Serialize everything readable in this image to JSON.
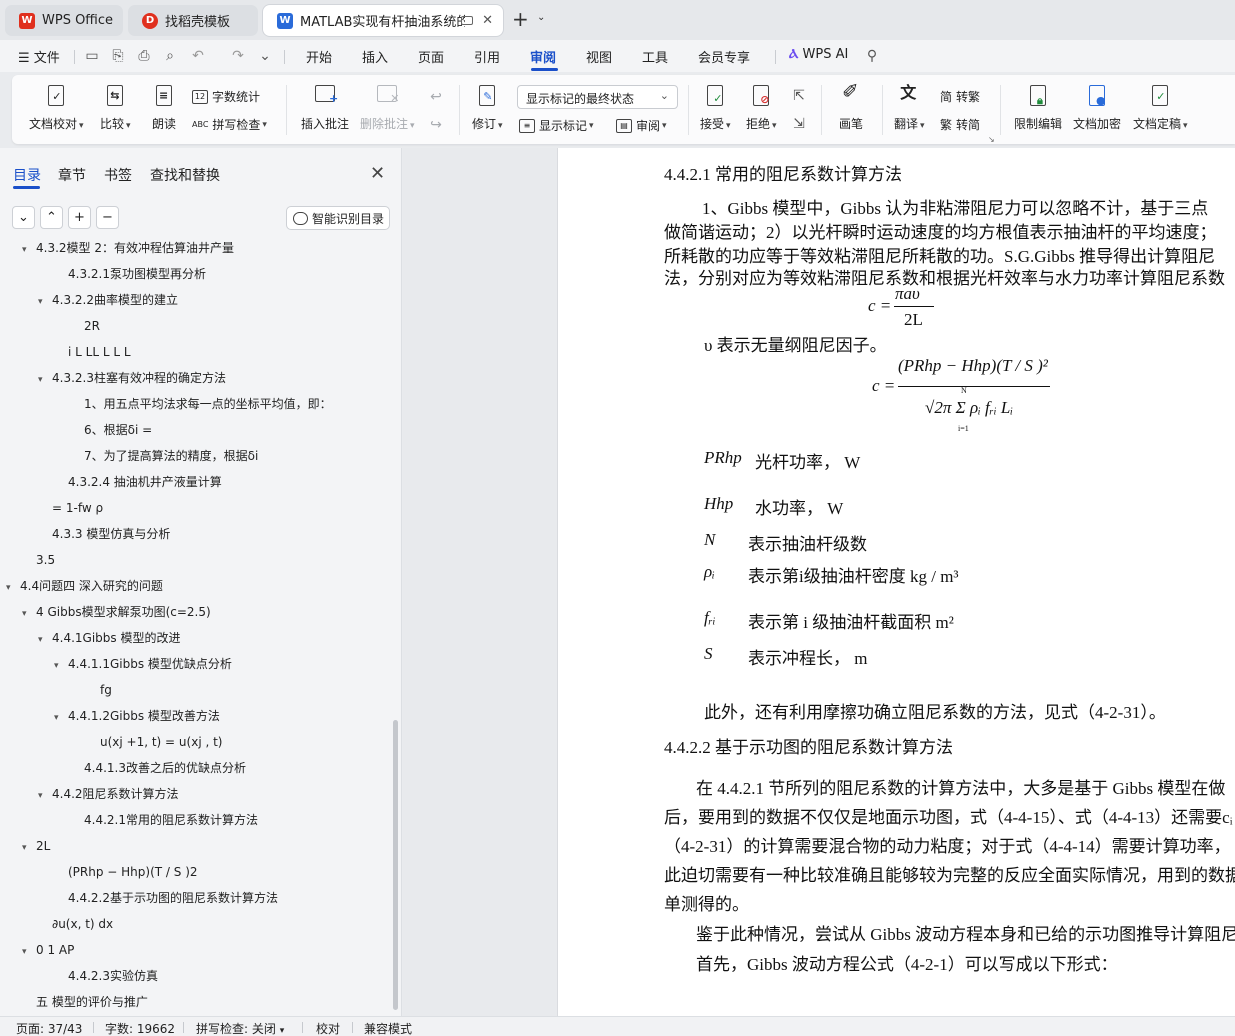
{
  "tabs": [
    {
      "label": "WPS Office",
      "icon": "wps-logo-icon",
      "color": "#e0301e"
    },
    {
      "label": "找稻壳模板",
      "icon": "docer-icon",
      "color": "#e0301e"
    },
    {
      "label": "MATLAB实现有杆抽油系统的",
      "icon": "word-doc-icon",
      "color": "#2a6bd9"
    }
  ],
  "menu": {
    "file": "文件",
    "items": [
      "开始",
      "插入",
      "页面",
      "引用",
      "审阅",
      "视图",
      "工具",
      "会员专享"
    ],
    "active": "审阅",
    "ai": "WPS AI"
  },
  "ribbon": {
    "doc_check": "文档校对",
    "compare": "比较",
    "read_aloud": "朗读",
    "word_count": "字数统计",
    "spell_check": "拼写检查",
    "insert_comment": "插入批注",
    "delete_comment": "删除批注",
    "track": "修订",
    "markup_select": "显示标记的最终状态",
    "show_markup": "显示标记",
    "review": "审阅",
    "accept": "接受",
    "reject": "拒绝",
    "pen": "画笔",
    "translate": "翻译",
    "trad_simp_to": "繁转简",
    "simp_to_trad": "简转繁",
    "trad_char": "繁",
    "simp_char": "简",
    "to_label": "转",
    "restrict_edit": "限制编辑",
    "encrypt": "文档加密",
    "finalize": "文档定稿",
    "accent": "#1a4fc9"
  },
  "nav": {
    "tabs": [
      "目录",
      "章节",
      "书签",
      "查找和替换"
    ],
    "smart_toc": "智能识别目录",
    "toc": [
      {
        "text": "4.3.2模型 2：有效冲程估算油井产量",
        "arrow": "▾",
        "indent": 0
      },
      {
        "text": "4.3.2.1泵功图模型再分析",
        "arrow": "",
        "indent": 2
      },
      {
        "text": "4.3.2.2曲率模型的建立",
        "arrow": "▾",
        "indent": 1
      },
      {
        "text": "2R",
        "arrow": "",
        "indent": 3
      },
      {
        "text": "i L   LL L L L",
        "arrow": "",
        "indent": 2
      },
      {
        "text": "4.3.2.3柱塞有效冲程的确定方法",
        "arrow": "▾",
        "indent": 1
      },
      {
        "text": "1、用五点平均法求每一点的坐标平均值，即：",
        "arrow": "",
        "indent": 3
      },
      {
        "text": "6、根据δi =",
        "arrow": "",
        "indent": 3
      },
      {
        "text": "7、为了提高算法的精度，根据δi",
        "arrow": "",
        "indent": 3
      },
      {
        "text": "4.3.2.4 抽油机井产液量计算",
        "arrow": "",
        "indent": 2
      },
      {
        "text": "= 1-fw ρ",
        "arrow": "",
        "indent": 1
      },
      {
        "text": "4.3.3 模型仿真与分析",
        "arrow": "",
        "indent": 1
      },
      {
        "text": "3.5",
        "arrow": "",
        "indent": 0
      },
      {
        "text": "4.4问题四 深入研究的问题",
        "arrow": "▾",
        "indent": -1
      },
      {
        "text": "4 Gibbs模型求解泵功图(c=2.5)",
        "arrow": "▾",
        "indent": 0
      },
      {
        "text": "4.4.1Gibbs 模型的改进",
        "arrow": "▾",
        "indent": 1
      },
      {
        "text": "4.4.1.1Gibbs 模型优缺点分析",
        "arrow": "▾",
        "indent": 2
      },
      {
        "text": "fg",
        "arrow": "",
        "indent": 4
      },
      {
        "text": "4.4.1.2Gibbs 模型改善方法",
        "arrow": "▾",
        "indent": 2
      },
      {
        "text": "u(xj +1, t) = u(xj , t)",
        "arrow": "",
        "indent": 4
      },
      {
        "text": "4.4.1.3改善之后的优缺点分析",
        "arrow": "",
        "indent": 3
      },
      {
        "text": "4.4.2阻尼系数计算方法",
        "arrow": "▾",
        "indent": 1
      },
      {
        "text": "4.4.2.1常用的阻尼系数计算方法",
        "arrow": "",
        "indent": 3
      },
      {
        "text": "2L",
        "arrow": "▾",
        "indent": 0
      },
      {
        "text": "(PRhp − Hhp)(T / S )2",
        "arrow": "",
        "indent": 2
      },
      {
        "text": "4.4.2.2基于示功图的阻尼系数计算方法",
        "arrow": "",
        "indent": 2
      },
      {
        "text": "∂u(x, t) dx",
        "arrow": "",
        "indent": 1
      },
      {
        "text": "0  1  AP",
        "arrow": "▾",
        "indent": 0
      },
      {
        "text": "4.4.2.3实验仿真",
        "arrow": "",
        "indent": 2
      },
      {
        "text": "五 模型的评价与推广",
        "arrow": "",
        "indent": 0
      }
    ]
  },
  "document": {
    "heading1": "4.4.2.1  常用的阻尼系数计算方法",
    "para1": [
      "1、Gibbs 模型中，Gibbs 认为非粘滞阻尼力可以忽略不计，基于三点",
      "做简谐运动；2）以光杆瞬时运动速度的均方根值表示抽油杆的平均速度；",
      "所耗散的功应等于等效粘滞阻尼所耗散的功。S.G.Gibbs 推导得出计算阻尼",
      "法，分别对应为等效粘滞阻尼系数和根据光杆效率与水力功率计算阻尼系数"
    ],
    "eq1_lhs": "c =",
    "eq1_num": "πaυ",
    "eq1_den": "2L",
    "upsilon_desc": "υ 表示无量纲阻尼因子。",
    "eq2_lhs": "c =",
    "eq2_num": "(PRhp − Hhp)(T / S )²",
    "eq2_den": "√2π Σ ρᵢ fᵣᵢ Lᵢ",
    "eq2_sum_top": "N",
    "eq2_sum_bot": "i=1",
    "defs": [
      {
        "sym": "PRhp",
        "text": "光杆功率，  W"
      },
      {
        "sym": "Hhp",
        "text": "水功率，  W"
      },
      {
        "sym": "N",
        "text": "表示抽油杆级数"
      },
      {
        "sym": "ρᵢ",
        "text": "表示第i级抽油杆密度   kg / m³"
      },
      {
        "sym": "fᵣᵢ",
        "text": "表示第  i 级抽油杆截面积  m²"
      },
      {
        "sym": "S",
        "text": "表示冲程长，  m"
      }
    ],
    "para2": "此外，还有利用摩擦功确立阻尼系数的方法，见式（4-2-31）。",
    "heading2": "4.4.2.2  基于示功图的阻尼系数计算方法",
    "para3": [
      "在 4.4.2.1 节所列的阻尼系数的计算方法中，大多是基于  Gibbs 模型在做",
      "后，要用到的数据不仅仅是地面示功图，式（4-4-15）、式（4-4-13）还需要cᵢ -",
      "（4-2-31）的计算需要混合物的动力粘度；对于式（4-4-14）需要计算功率，",
      "此迫切需要有一种比较准确且能够较为完整的反应全面实际情况，用到的数据",
      "单测得的。"
    ],
    "para4": [
      "鉴于此种情况，尝试从 Gibbs 波动方程本身和已给的示功图推导计算阻尼",
      "首先，Gibbs 波动方程公式（4-2-1）可以写成以下形式："
    ]
  },
  "status": {
    "page": "页面: 37/43",
    "words": "字数: 19662",
    "spell": "拼写检查: 关闭",
    "proof": "校对",
    "compat": "兼容模式"
  }
}
